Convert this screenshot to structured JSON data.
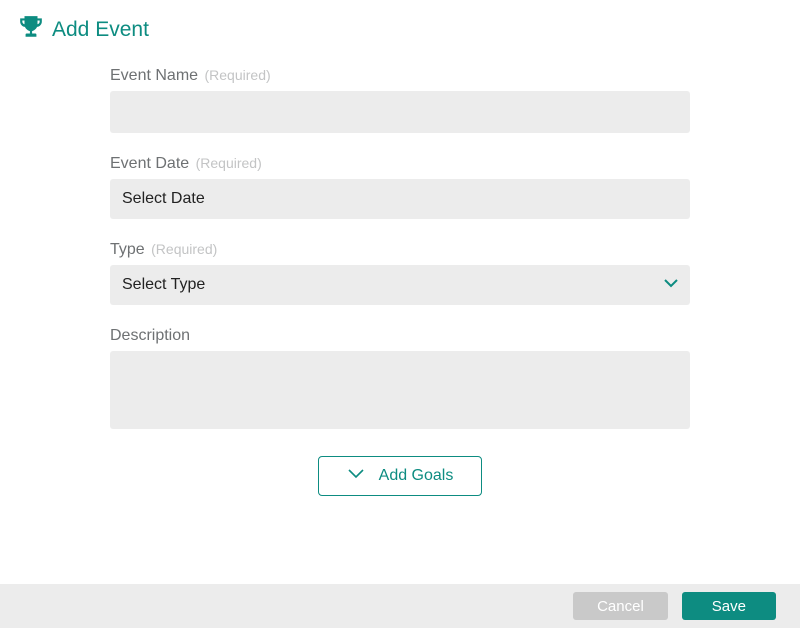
{
  "header": {
    "title": "Add Event"
  },
  "fields": {
    "eventName": {
      "label": "Event Name",
      "required": "(Required)",
      "value": ""
    },
    "eventDate": {
      "label": "Event Date",
      "required": "(Required)",
      "value": "Select Date"
    },
    "type": {
      "label": "Type",
      "required": "(Required)",
      "value": "Select Type"
    },
    "description": {
      "label": "Description",
      "value": ""
    }
  },
  "addGoals": {
    "label": "Add Goals"
  },
  "footer": {
    "cancel": "Cancel",
    "save": "Save"
  },
  "colors": {
    "accent": "#0d8c81",
    "muted": "#ececec"
  }
}
